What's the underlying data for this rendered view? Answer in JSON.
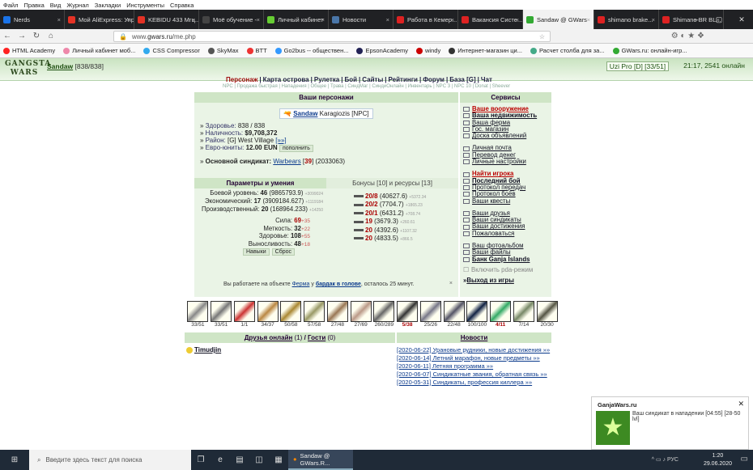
{
  "menubar": [
    "Файл",
    "Правка",
    "Вид",
    "Журнал",
    "Закладки",
    "Инструменты",
    "Справка"
  ],
  "tabs": [
    {
      "label": "Nerds",
      "color": "#1a73e8"
    },
    {
      "label": "Мой AliExpress: Упр",
      "color": "#e43225"
    },
    {
      "label": "KEBIDU 433 Мгц...",
      "color": "#e43225"
    },
    {
      "label": "Моё обучение -",
      "color": "#444"
    },
    {
      "label": "Личный кабинет",
      "color": "#6c3"
    },
    {
      "label": "Новости",
      "color": "#4a76a8"
    },
    {
      "label": "Работа в Кемер...",
      "color": "#d22"
    },
    {
      "label": "Вакансия Систе...",
      "color": "#d22"
    },
    {
      "label": "Sandaw @ GWars",
      "color": "#3a3",
      "active": true
    },
    {
      "label": "shimano brake...",
      "color": "#d22"
    },
    {
      "label": "Shimano BR BL...",
      "color": "#d22"
    }
  ],
  "url": {
    "prefix": "www.",
    "host": "gwars.ru",
    "path": "/me.php"
  },
  "bookmarks": [
    {
      "label": "HTML Academy",
      "color": "#f22"
    },
    {
      "label": "Личный кабинет моб...",
      "color": "#e8a"
    },
    {
      "label": "CSS Compressor",
      "color": "#3ae"
    },
    {
      "label": "SkyMax",
      "color": "#555"
    },
    {
      "label": "BTT",
      "color": "#e33"
    },
    {
      "label": "Go2bus -- обществен...",
      "color": "#39f"
    },
    {
      "label": "EpsonAcademy",
      "color": "#225"
    },
    {
      "label": "windy",
      "color": "#c00"
    },
    {
      "label": "Интернет-магазин ци...",
      "color": "#333"
    },
    {
      "label": "Расчет столба для за...",
      "color": "#4a8"
    },
    {
      "label": "GWars.ru: онлайн-игр...",
      "color": "#3a3"
    }
  ],
  "game": {
    "logo": "GANGSTA WARS",
    "player": "Sandaw",
    "player_hp": "[838/838]",
    "syndicate_link": "Uzi Pro [D] [33/51]",
    "clock": "21:17, 2541 онлайн",
    "nav": [
      "Персонаж",
      "Карта острова",
      "Рулетка",
      "Бой",
      "Сайты",
      "Рейтинги",
      "Форум",
      "База [G]",
      "Чат"
    ],
    "subnav": "NPC | Продажа быстрая | Нападения | Общее | Трава | СиндМаг | СиндиОнлайн | Инвентарь | NPC 3 | NPC 10 | Donat | Sheever",
    "chars_header": "Ваши персонажи",
    "services_header": "Сервисы",
    "char_name": "Sandaw",
    "char_npc": "Karagiozis [NPC]",
    "health_label": "Здоровье:",
    "health": "838 / 838",
    "cash_label": "Наличность:",
    "cash": "$9,708,372",
    "district_label": "Район:",
    "district": "[G] West Village",
    "district_more": "[»»]",
    "euro_label": "Евро-юниты:",
    "euro": "12.00 EUN",
    "euro_btn": "пополнить",
    "synd_label": "Основной синдикат:",
    "synd_name": "Warbears",
    "synd_lvl": "39",
    "synd_pts": "(2033063)",
    "skills_header": "Параметры и умения",
    "bonus_header": "Бонусы [10] и ресурсы [13]",
    "levels": [
      {
        "label": "Боевой уровень:",
        "v": "46",
        "x": "(9865793.9)",
        "g": "+3099024"
      },
      {
        "label": "Экономический:",
        "v": "17",
        "x": "(3909184.627)",
        "g": "+1119184"
      },
      {
        "label": "Производственный:",
        "v": "20",
        "x": "(168964.233)",
        "g": "+14250"
      }
    ],
    "attrs": [
      {
        "label": "Сила:",
        "v": "69",
        "a": "+35"
      },
      {
        "label": "Меткость:",
        "v": "32",
        "a": "+22"
      },
      {
        "label": "Здоровье:",
        "v": "108",
        "a": "+55"
      },
      {
        "label": "Выносливость:",
        "v": "48",
        "a": "+18"
      }
    ],
    "skills_btn": "Навыки",
    "reset_btn": "Сброс",
    "weapons": [
      {
        "v": "20/8",
        "x": "(40627.6)",
        "g": "+5372.34"
      },
      {
        "v": "20/2",
        "x": "(7704.7)",
        "g": "+1865.23"
      },
      {
        "v": "20/1",
        "x": "(6431.2)",
        "g": "+708.74"
      },
      {
        "v": "19",
        "x": "(3679.3)",
        "g": "+260.61"
      },
      {
        "v": "20",
        "x": "(4392.6)",
        "g": "+1107.32"
      },
      {
        "v": "20",
        "x": "(4833.5)",
        "g": "+866.5"
      }
    ],
    "work_text_1": "Вы работаете на объекте",
    "work_obj": "Ферма",
    "work_text_2": "у",
    "work_boss": "бардак в голове",
    "work_text_3": ", осталось 25 минут.",
    "services": [
      {
        "label": "Ваше вооружение",
        "style": "r b"
      },
      {
        "label": "Ваша недвижимость",
        "style": "b"
      },
      {
        "label": "Ваша ферма",
        "style": ""
      },
      {
        "label": "Гос. магазин",
        "style": ""
      },
      {
        "label": "Доска объявлений",
        "style": ""
      },
      {
        "gap": true
      },
      {
        "label": "Личная почта",
        "style": ""
      },
      {
        "label": "Перевод денег",
        "style": ""
      },
      {
        "label": "Личные настройки",
        "style": ""
      },
      {
        "gap": true
      },
      {
        "label": "Найти игрока",
        "style": "r b"
      },
      {
        "label": "Последний бой",
        "style": "b"
      },
      {
        "label": "Протокол передач",
        "style": ""
      },
      {
        "label": "Протокол боёв",
        "style": ""
      },
      {
        "label": "Ваши квесты",
        "style": ""
      },
      {
        "gap": true
      },
      {
        "label": "Ваши друзья",
        "style": ""
      },
      {
        "label": "Ваши синдикаты",
        "style": ""
      },
      {
        "label": "Ваши достижения",
        "style": ""
      },
      {
        "label": "Пожаловаться",
        "style": ""
      },
      {
        "gap": true
      },
      {
        "label": "Ваш фотоальбом",
        "style": ""
      },
      {
        "label": "Ваши файлы",
        "style": ""
      },
      {
        "label": "Банк Ganja Islands",
        "style": "b"
      }
    ],
    "pda": "Включить pda-режим",
    "exit": "Выход из игры",
    "inventory": [
      {
        "c": "33/51"
      },
      {
        "c": "33/51"
      },
      {
        "c": "1/1"
      },
      {
        "c": "34/37"
      },
      {
        "c": "50/58"
      },
      {
        "c": "57/58"
      },
      {
        "c": "27/48"
      },
      {
        "c": "27/69"
      },
      {
        "c": "260/289"
      },
      {
        "c": "5/38",
        "red": true
      },
      {
        "c": "25/26"
      },
      {
        "c": "22/48"
      },
      {
        "c": "100/100"
      },
      {
        "c": "4/11",
        "red": true
      },
      {
        "c": "7/14"
      },
      {
        "c": "20/30"
      }
    ],
    "friends_label": "Друзья онлайн",
    "friends_count": "(1)",
    "sep": "/",
    "guests_label": "Гости",
    "guests_count": "(0)",
    "friend": "Timudjin",
    "news_header": "Новости",
    "news": [
      "[2020-06-22] Урановые рудники, новые достижения »»",
      "[2020-06-14] Летний марафон, новые предметы »»",
      "[2020-06-11] Летняя программа »»",
      "[2020-06-07] Синдикатные звания, обратная связь »»",
      "[2020-05-31] Синдикаты, профессия киллера »»"
    ]
  },
  "notification": {
    "title": "GanjaWars.ru",
    "message": "Ваш синдикат в нападении [04:55] [28-50 lvl]"
  },
  "taskbar": {
    "search": "Введите здесь текст для поиска",
    "active": "Sandaw @ GWars.R...",
    "time": "1:20",
    "date": "29.06.2020",
    "lang": "РУС"
  }
}
